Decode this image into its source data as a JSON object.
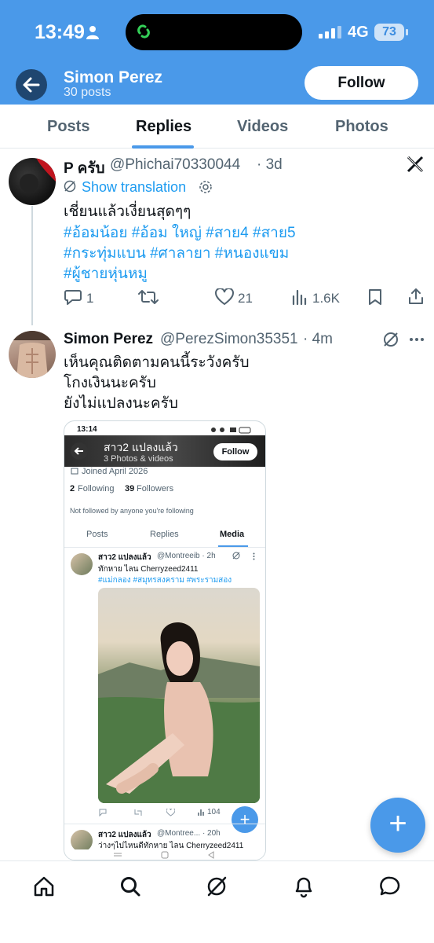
{
  "status_bar": {
    "time": "13:49",
    "network": "4G",
    "battery": "73"
  },
  "header": {
    "name": "Simon Perez",
    "posts": "30 posts",
    "follow_label": "Follow"
  },
  "tabs": [
    {
      "label": "Posts"
    },
    {
      "label": "Replies"
    },
    {
      "label": "Videos"
    },
    {
      "label": "Photos"
    }
  ],
  "post1": {
    "name": "P ครับ",
    "handle": "@Phichai70330044",
    "time": "· 3d",
    "show_translation": "Show translation",
    "text": "เชี่ยนแล้วเงี่ยนสุดๆๆ",
    "hashtags": [
      "#อ้อมน้อย #อ้อม ใหญ่ #สาย4 #สาย5",
      "#กระทุ่มแบน #ศาลายา #หนองแขม",
      "#ผู้ชายหุ่นหมู"
    ],
    "replies": "1",
    "reposts": "",
    "likes": "21",
    "views": "1.6K"
  },
  "post2": {
    "name": "Simon Perez",
    "handle": "@PerezSimon35351",
    "time": "· 4m",
    "lines": [
      "เห็นคุณติดตามคนนี้ระวังครับ",
      "โกงเงินนะครับ",
      "ยังไม่แปลงนะครับ"
    ]
  },
  "screenshot": {
    "time": "13:14",
    "profile_name": "สาว2 แปลงแล้ว",
    "profile_sub": "3 Photos & videos",
    "follow_label": "Follow",
    "joined": "Joined April 2026",
    "following_count": "2",
    "following_label": "Following",
    "followers_count": "39",
    "followers_label": "Followers",
    "not_followed": "Not followed by anyone you're following",
    "tabs": [
      "Posts",
      "Replies",
      "Media"
    ],
    "post_name": "สาว2 แปลงแล้ว",
    "post_handle": "@Montreeib · 2h",
    "post_text": "ทักหาย ไลน Cherryzeed2411",
    "post_tags": "#แม่กลอง #สมุทรสงคราม #พระรามสอง",
    "views": "104",
    "post2_name": "สาว2 แปลงแล้ว",
    "post2_handle": "@Montree... · 20h",
    "post2_text": "ว่างๆไปไหนดีทักหาย ไลน Cherryzeed2411"
  },
  "colors": {
    "accent": "#4a99e9",
    "header_bg": "#4a99e9",
    "link": "#1d9bf0",
    "muted": "#536471"
  }
}
